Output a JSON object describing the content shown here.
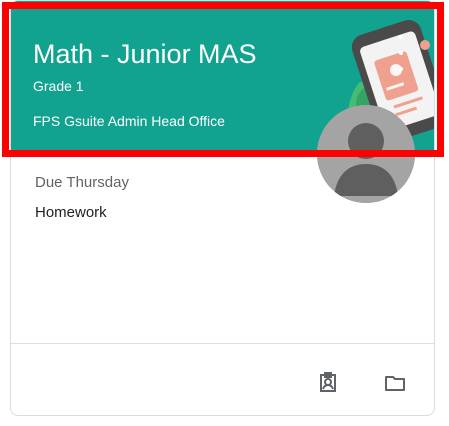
{
  "course": {
    "title": "Math - Junior MAS",
    "section": "Grade 1",
    "owner": "FPS Gsuite Admin Head Office",
    "theme_color": "#11a38f"
  },
  "assignment": {
    "due": "Due Thursday",
    "title": "Homework"
  },
  "icons": {
    "menu": "more-vert-icon",
    "avatar": "person-avatar-icon",
    "work": "assignment-ind-icon",
    "folder": "folder-icon"
  },
  "annotation": {
    "highlight_color": "#ff0000"
  }
}
